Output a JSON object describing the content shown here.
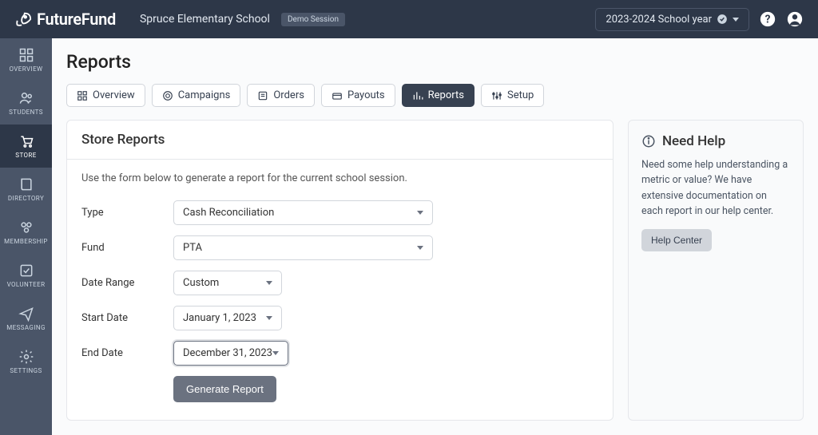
{
  "brand": "FutureFund",
  "schoolName": "Spruce Elementary School",
  "sessionBadge": "Demo Session",
  "yearPicker": "2023-2024 School year",
  "nav": {
    "overview": "OVERVIEW",
    "students": "STUDENTS",
    "store": "STORE",
    "directory": "DIRECTORY",
    "membership": "MEMBERSHIP",
    "volunteer": "VOLUNTEER",
    "messaging": "MESSAGING",
    "settings": "SETTINGS"
  },
  "pageTitle": "Reports",
  "tabs": {
    "overview": "Overview",
    "campaigns": "Campaigns",
    "orders": "Orders",
    "payouts": "Payouts",
    "reports": "Reports",
    "setup": "Setup"
  },
  "card": {
    "title": "Store Reports",
    "desc": "Use the form below to generate a report for the current school session."
  },
  "form": {
    "typeLabel": "Type",
    "typeValue": "Cash Reconciliation",
    "fundLabel": "Fund",
    "fundValue": "PTA",
    "dateRangeLabel": "Date Range",
    "dateRangeValue": "Custom",
    "startDateLabel": "Start Date",
    "startDateValue": "January 1, 2023",
    "endDateLabel": "End Date",
    "endDateValue": "December 31, 2023",
    "submit": "Generate Report"
  },
  "help": {
    "title": "Need Help",
    "text": "Need some help understanding a metric or value? We have extensive documentation on each report in our help center.",
    "button": "Help Center"
  }
}
